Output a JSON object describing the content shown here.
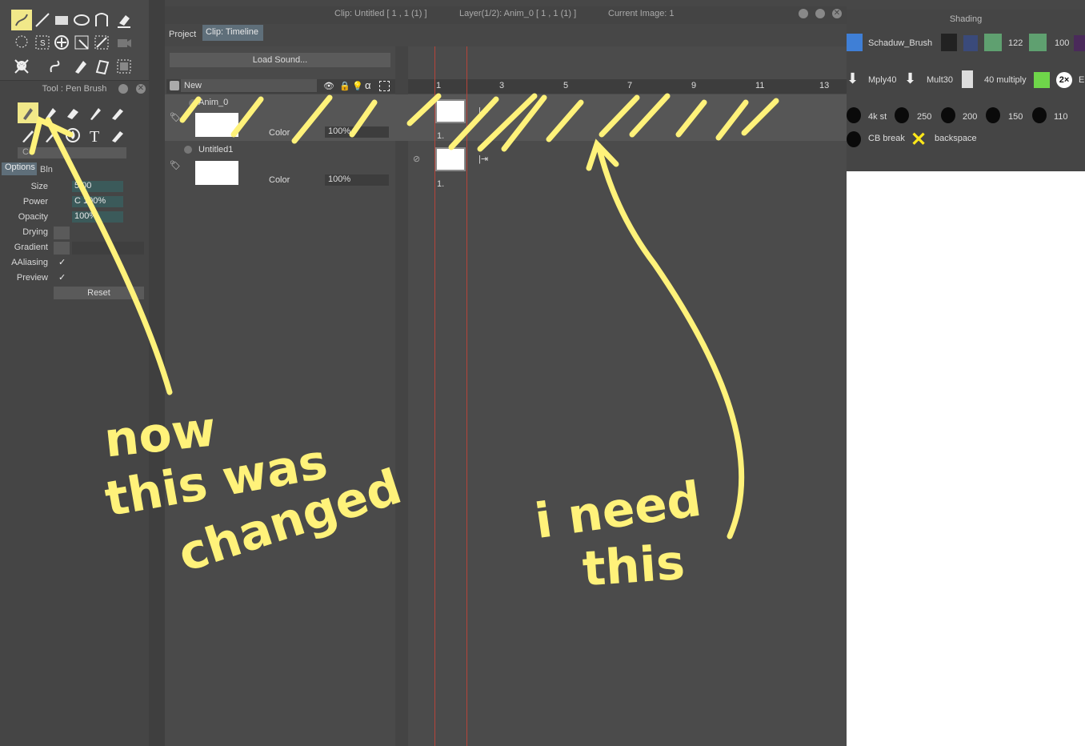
{
  "left_tools": {
    "tool_panel_title": "Tool : Pen Brush",
    "options_tab": "Options",
    "blend_tab": "Bln",
    "color_dropdown": "Co",
    "options": [
      {
        "label": "Size",
        "value": "5.00"
      },
      {
        "label": "Power",
        "value": "C 100%"
      },
      {
        "label": "Opacity",
        "value": "100%"
      },
      {
        "label": "Drying",
        "value": ""
      },
      {
        "label": "Gradient",
        "value": ""
      },
      {
        "label": "AAliasing",
        "value": "✓"
      },
      {
        "label": "Preview",
        "value": "✓"
      }
    ],
    "reset_label": "Reset"
  },
  "timeline": {
    "clip_title": "Clip: Untitled [ 1 , 1  (1) ]",
    "layer_title": "Layer(1/2): Anim_0 [ 1 , 1  (1) ]",
    "current_image": "Current Image: 1",
    "tabs": [
      "Project",
      "Clip: Timeline"
    ],
    "load_sound": "Load Sound...",
    "new_label": "New",
    "ruler_ticks": [
      "1",
      "3",
      "5",
      "7",
      "9",
      "11",
      "13"
    ],
    "layers": [
      {
        "name": "Anim_0",
        "blend": "Color",
        "opacity": "100%",
        "cell_label": "1."
      },
      {
        "name": "Untitled1",
        "blend": "Color",
        "opacity": "100%",
        "cell_label": "1."
      }
    ]
  },
  "right_panel": {
    "title": "Shading",
    "row1": [
      "Schaduw_Brush",
      "122",
      "100"
    ],
    "row2": [
      "Mply40",
      "Mult30",
      "40 multiply",
      "2×",
      "E"
    ],
    "row3": [
      "4k st",
      "250",
      "200",
      "150",
      "110"
    ],
    "row4": [
      "CB break",
      "backspace"
    ]
  },
  "annotations": {
    "left_note": [
      "now",
      "this was",
      "changed"
    ],
    "right_note": [
      "i need",
      "this"
    ]
  },
  "colors": {
    "annotation": "#fff27a",
    "accent_teal": "#3b5a5a",
    "playhead": "#b5443a"
  }
}
